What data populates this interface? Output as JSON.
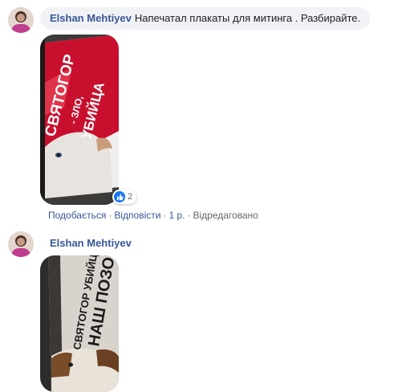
{
  "comment1": {
    "author": "Elshan Mehtiyev",
    "text": "Напечатал плакаты для митинга . Разбирайте.",
    "poster_lines": [
      "СВЯТОГОР",
      "- ЗЛО,",
      "УБИЙЦА"
    ],
    "reactions": {
      "icon": "like-icon",
      "count": "2"
    },
    "actions": {
      "like": "Подобається",
      "reply": "Відповісти",
      "time": "1 р.",
      "edited": "Відредаговано"
    }
  },
  "comment2": {
    "author": "Elshan Mehtiyev",
    "poster_lines": [
      "СВЯТОГОР УБИЙЦА",
      "НАШ ПОЗОР!"
    ]
  },
  "colors": {
    "author_link": "#385898",
    "bubble_bg": "#f0f2f5",
    "like_blue": "#1877f2",
    "meta_gray": "#65676b"
  }
}
